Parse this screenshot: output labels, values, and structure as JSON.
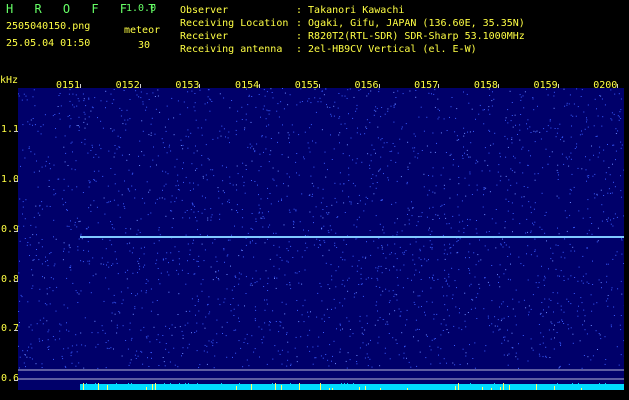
{
  "header": {
    "brand": "H R O F F T",
    "version": "1.0.0",
    "filename": "2505040150.png",
    "datetime": "25.05.04 01:50",
    "meteor_label": "meteor",
    "meteor_count": "30"
  },
  "info": [
    {
      "label": "Observer",
      "value": ": Takanori Kawachi"
    },
    {
      "label": "Receiving Location",
      "value": ": Ogaki, Gifu, JAPAN (136.60E, 35.35N)"
    },
    {
      "label": "Receiver",
      "value": ": R820T2(RTL-SDR) SDR-Sharp 53.1000MHz"
    },
    {
      "label": "Receiving antenna",
      "value": ": 2el-HB9CV Vertical (el. E-W)"
    }
  ],
  "axis": {
    "unit": "kHz",
    "x_ticks": [
      "0151",
      "0152",
      "0153",
      "0154",
      "0155",
      "0156",
      "0157",
      "0158",
      "0159",
      "0200"
    ],
    "y_ticks": [
      "1.1",
      "1.0",
      "0.9",
      "0.8",
      "0.7",
      "0.6"
    ]
  },
  "colors": {
    "brand": "#66ff66",
    "header_text": "#ffff44",
    "axis_text": "#ffff44",
    "background": "#00006a",
    "carrier": "#7fc8ff",
    "noise": "#3a5cff",
    "bottom_strip": "#00dcff"
  }
}
